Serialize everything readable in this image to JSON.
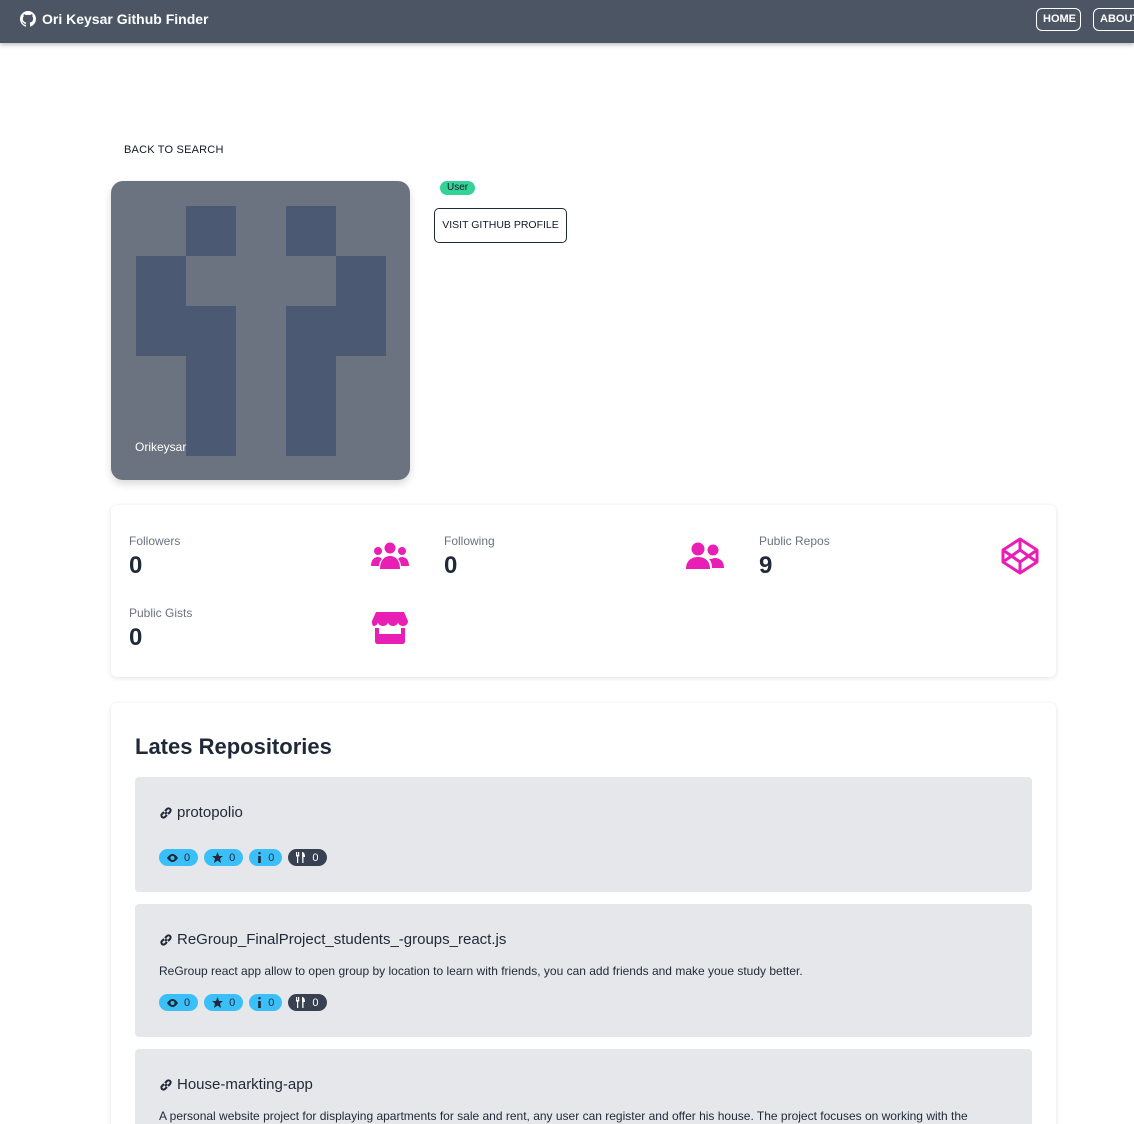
{
  "navbar": {
    "brand": "Ori Keysar Github Finder",
    "home_label": "HOME",
    "about_label": "ABOUT"
  },
  "profile": {
    "back_label": "BACK TO SEARCH",
    "name": "Orikeysar",
    "type_badge": "User",
    "visit_label": "VISIT GITHUB PROFILE"
  },
  "stats": {
    "followers": {
      "label": "Followers",
      "value": "0"
    },
    "following": {
      "label": "Following",
      "value": "0"
    },
    "public_repos": {
      "label": "Public Repos",
      "value": "9"
    },
    "public_gists": {
      "label": "Public Gists",
      "value": "0"
    }
  },
  "repos": {
    "title": "Lates Repositories",
    "items": [
      {
        "name": "protopolio",
        "description": "",
        "watchers": "0",
        "stars": "0",
        "issues": "0",
        "forks": "0"
      },
      {
        "name": "ReGroup_FinalProject_students_-groups_react.js",
        "description": "ReGroup react app allow to open group by location to learn with friends, you can add friends and make youe study better.",
        "watchers": "0",
        "stars": "0",
        "issues": "0",
        "forks": "0"
      },
      {
        "name": "House-markting-app",
        "description": "A personal website project for displaying apartments for sale and rent, any user can register and offer his house. The project focuses on working with the"
      }
    ]
  },
  "colors": {
    "navbar": "#4b5563",
    "accent_icon": "#e91eb4",
    "badge": "#36d399",
    "pill_blue": "#3abff8",
    "pill_dark": "#374151"
  },
  "icons": [
    "github-icon",
    "users-icon",
    "user-friends-icon",
    "codepen-icon",
    "store-icon",
    "link-icon",
    "eye-icon",
    "star-icon",
    "info-icon",
    "utensils-icon"
  ]
}
